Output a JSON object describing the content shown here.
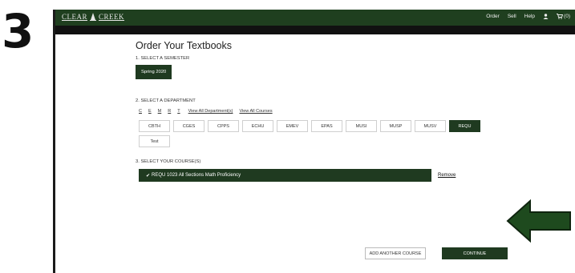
{
  "step": {
    "number": "3"
  },
  "header": {
    "logo_left": "CLEAR",
    "logo_right": "CREEK",
    "nav": [
      "Order",
      "Sell",
      "Help"
    ],
    "cart_count": "(0)"
  },
  "page": {
    "title": "Order Your Textbooks",
    "section1_label": "1. SELECT A SEMESTER",
    "semester": "Spring 2020",
    "section2_label": "2. SELECT A DEPARTMENT",
    "letters": [
      "C",
      "E",
      "M",
      "R",
      "T"
    ],
    "view_all_departments": "View All Department(s)",
    "view_all_courses": "View All Courses",
    "departments": [
      "CBTH",
      "CGES",
      "CPPS",
      "ECHU",
      "EMEV",
      "EPAS",
      "MUSI",
      "MUSP",
      "MUSV",
      "REQU",
      "Test"
    ],
    "selected_department": "REQU",
    "section3_label": "3. SELECT YOUR COURSE(S)",
    "course": "REQU 1023 All Sections  Math Proficiency",
    "remove": "Remove",
    "add_another": "ADD ANOTHER COURSE",
    "continue": "CONTINUE"
  },
  "colors": {
    "brand_green": "#1f3a20",
    "arrow_green": "#1e4a1e"
  }
}
